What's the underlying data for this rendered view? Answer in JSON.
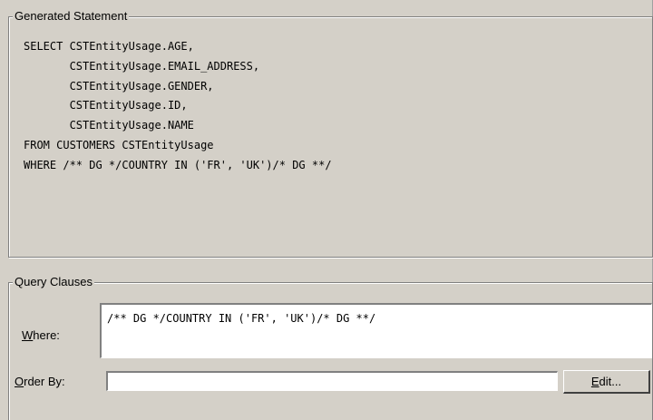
{
  "generated_statement": {
    "title": "Generated Statement",
    "sql_lines": [
      "SELECT CSTEntityUsage.AGE,",
      "       CSTEntityUsage.EMAIL_ADDRESS,",
      "       CSTEntityUsage.GENDER,",
      "       CSTEntityUsage.ID,",
      "       CSTEntityUsage.NAME",
      "FROM CUSTOMERS CSTEntityUsage",
      "WHERE /** DG */COUNTRY IN ('FR', 'UK')/* DG **/"
    ]
  },
  "query_clauses": {
    "title": "Query Clauses",
    "where_label_mnemonic": "W",
    "where_label_rest": "here:",
    "where_value": "/** DG */COUNTRY IN ('FR', 'UK')/* DG **/",
    "order_by_label_mnemonic": "O",
    "order_by_label_rest": "rder By:",
    "order_by_value": "",
    "edit_button_mnemonic": "E",
    "edit_button_rest": "dit..."
  }
}
